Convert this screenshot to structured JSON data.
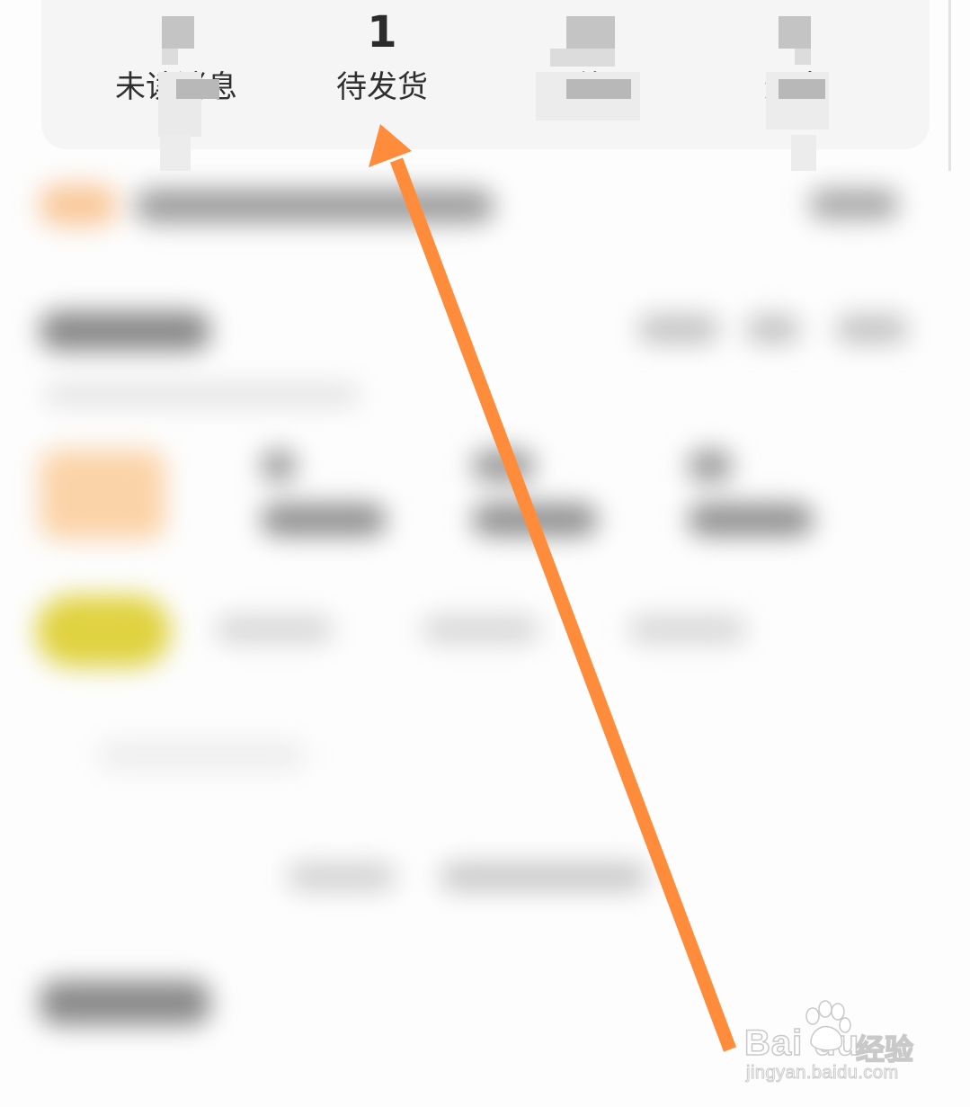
{
  "stats": [
    {
      "id": "unread",
      "count": "",
      "label": "未读消息"
    },
    {
      "id": "to-ship",
      "count": "1",
      "label": "待发货"
    },
    {
      "id": "to-pay",
      "count": "",
      "label": "待"
    },
    {
      "id": "refund",
      "count": "",
      "label": "退中"
    }
  ],
  "annotation": {
    "arrow_color": "#ff8c3b",
    "points_to": "to-ship"
  },
  "watermark": {
    "brand": "Bai du",
    "brand_cn": "经验",
    "url": "jingyan.baidu.com"
  },
  "colors": {
    "card_background": "#f5f5f5",
    "page_background": "#fdfdfd",
    "arrow": "#ff8c3b",
    "blurred_accent_orange": "#f8c58f",
    "blurred_accent_yellow": "#e4d94a"
  }
}
